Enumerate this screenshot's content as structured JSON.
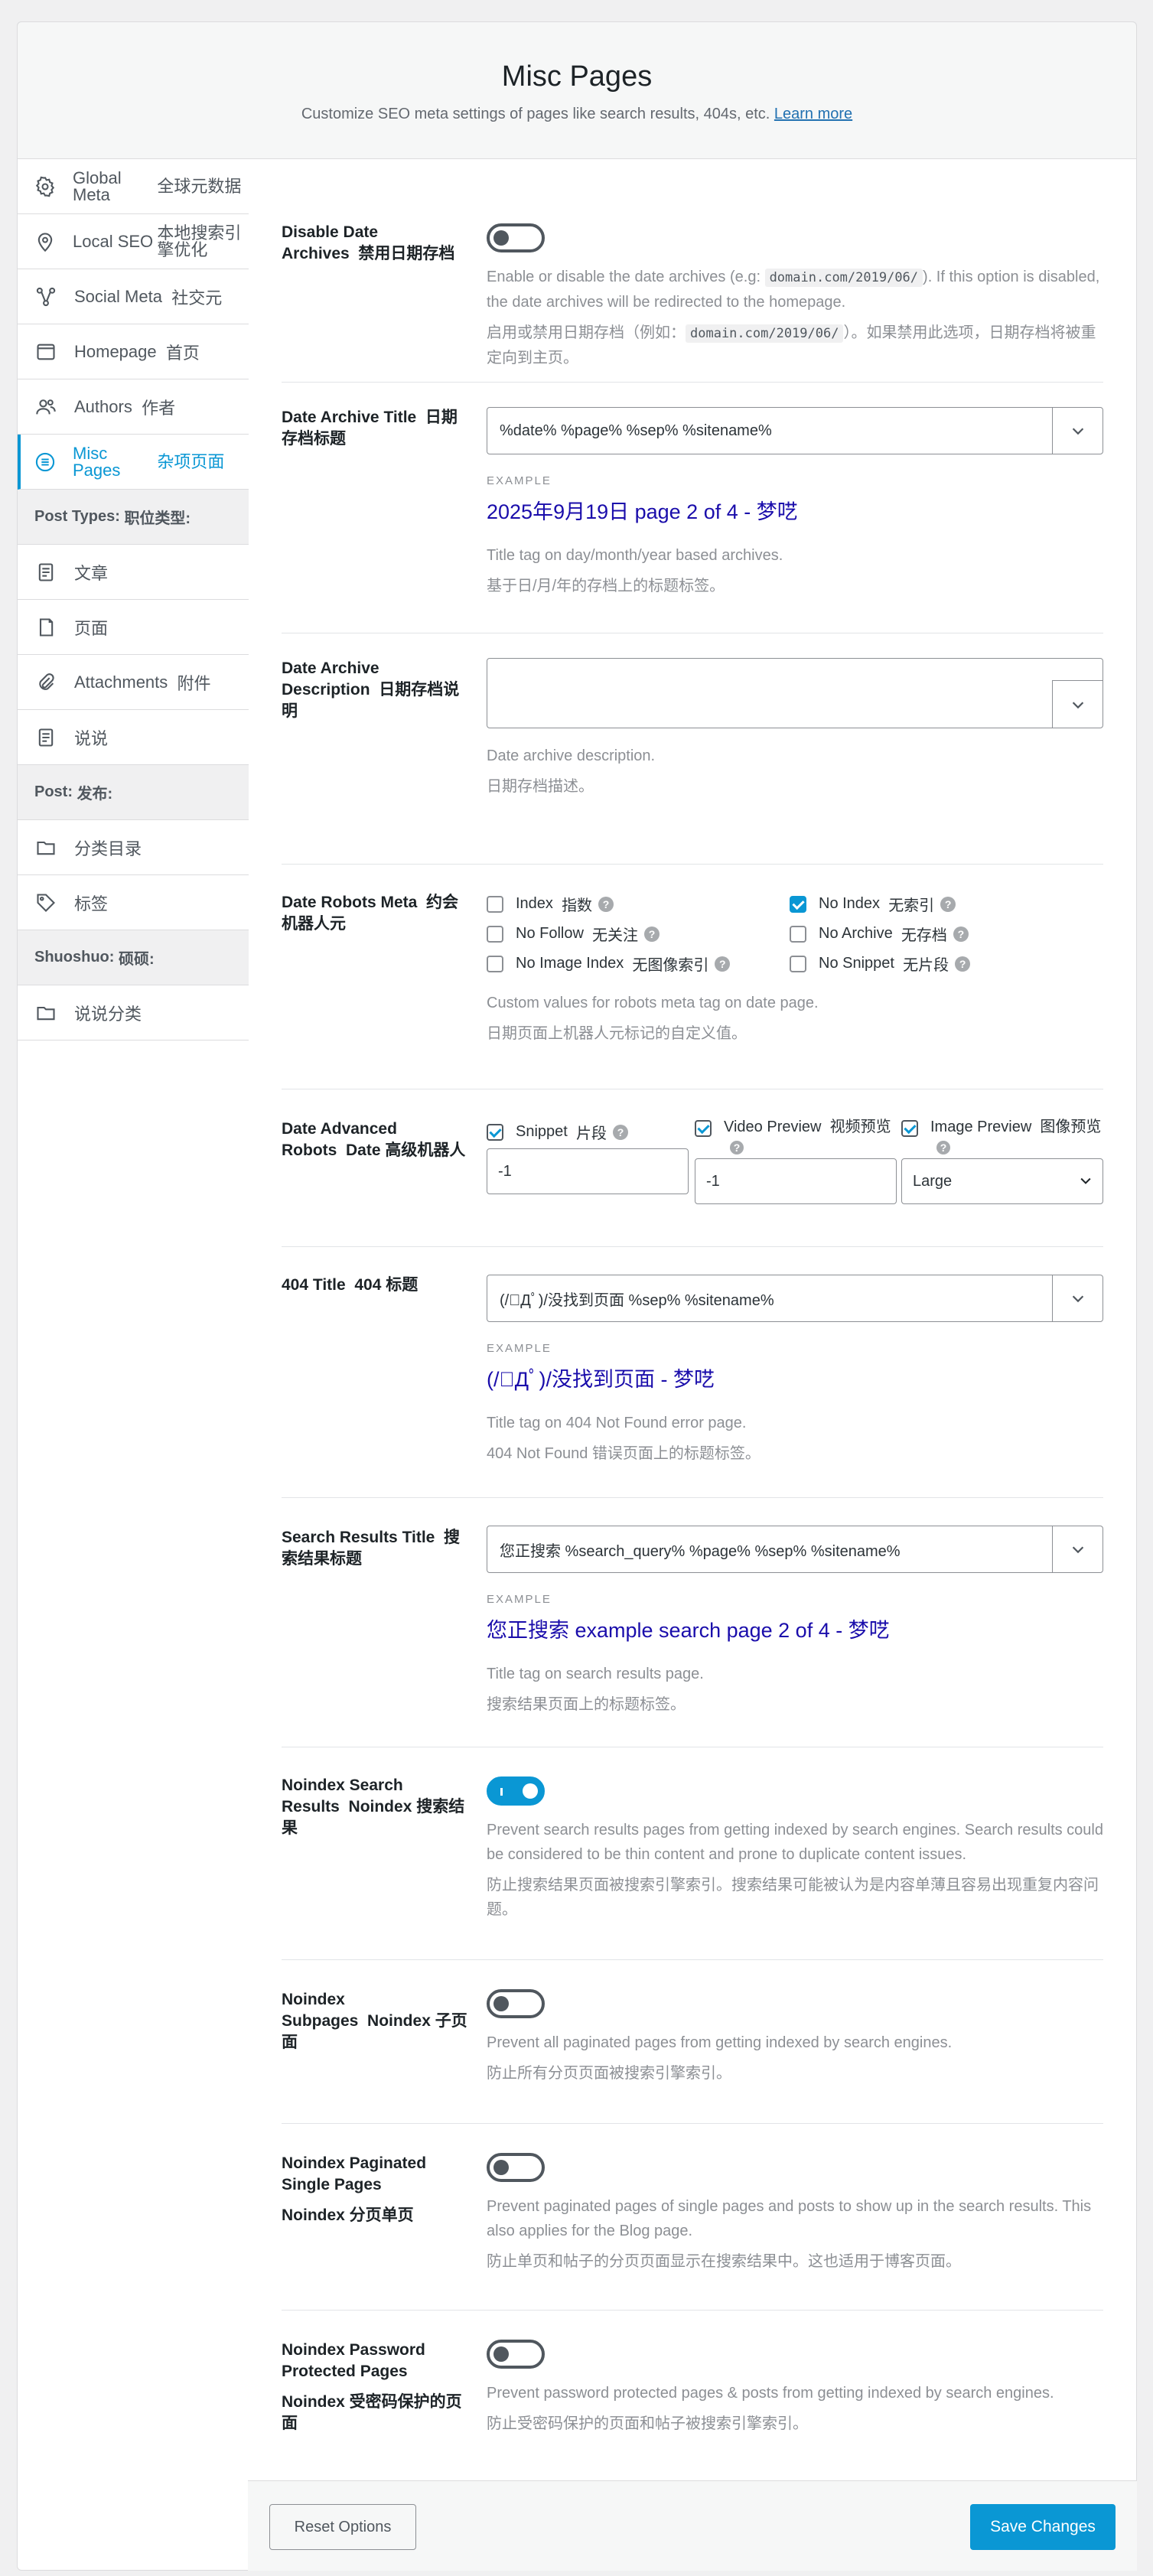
{
  "header": {
    "title": "Misc Pages",
    "subtitle": "Customize SEO meta settings of pages like search results, 404s, etc.",
    "learn_more": "Learn more"
  },
  "sidebar": {
    "items": [
      {
        "label": "Global Meta",
        "label_zh": "全球元数据",
        "icon": "gear-icon"
      },
      {
        "label": "Local SEO",
        "label_zh": "本地搜索引擎优化",
        "icon": "location-pin-icon"
      },
      {
        "label": "Social Meta",
        "label_zh": "社交元",
        "icon": "share-nodes-icon"
      },
      {
        "label": "Homepage",
        "label_zh": "首页",
        "icon": "browser-window-icon"
      },
      {
        "label": "Authors",
        "label_zh": "作者",
        "icon": "users-icon"
      },
      {
        "label": "Misc Pages",
        "label_zh": "杂项页面",
        "icon": "list-circle-icon"
      }
    ],
    "post_types_heading": "Post Types:",
    "post_types_heading_zh": "职位类型:",
    "post_types": [
      {
        "label": "文章",
        "icon": "document-icon"
      },
      {
        "label": "页面",
        "icon": "page-icon"
      },
      {
        "label": "Attachments",
        "label_zh": "附件",
        "icon": "paperclip-icon"
      },
      {
        "label": "说说",
        "icon": "document-icon"
      }
    ],
    "post_heading": "Post:",
    "post_heading_zh": "发布:",
    "post_tax": [
      {
        "label": "分类目录",
        "icon": "folder-icon"
      },
      {
        "label": "标签",
        "icon": "tag-icon"
      }
    ],
    "shuoshuo_heading": "Shuoshuo:",
    "shuoshuo_heading_zh": "硕硕:",
    "shuoshuo_tax": [
      {
        "label": "说说分类",
        "icon": "folder-icon"
      }
    ]
  },
  "settings": {
    "date_archives": {
      "label": "Disable Date Archives",
      "label_zh": "禁用日期存档",
      "desc1_a": "Enable or disable the date archives (e.g:",
      "desc1_code": "domain.com/2019/06/",
      "desc1_b": "). If this option is disabled, the date archives will be redirected to the homepage.",
      "desc2_a": "启用或禁用日期存档（例如：",
      "desc2_code": "domain.com/2019/06/",
      "desc2_b": "）。如果禁用此选项，日期存档将被重定向到主页。",
      "enabled": false
    },
    "date_title": {
      "label": "Date Archive Title",
      "label_zh": "日期存档标题",
      "value": "%date% %page% %sep% %sitename%",
      "example_tag": "EXAMPLE",
      "example": "2025年9月19日 page 2 of 4 - 梦呓",
      "desc": "Title tag on day/month/year based archives.",
      "desc_zh": "基于日/月/年的存档上的标题标签。"
    },
    "date_desc": {
      "label": "Date Archive Description",
      "label_zh": "日期存档说明",
      "value": "",
      "desc": "Date archive description.",
      "desc_zh": "日期存档描述。"
    },
    "robots": {
      "label": "Date Robots Meta",
      "label_zh": "约会机器人元",
      "options": [
        {
          "label": "Index",
          "label_zh": "指数",
          "checked": false
        },
        {
          "label": "No Index",
          "label_zh": "无索引",
          "checked": true
        },
        {
          "label": "No Follow",
          "label_zh": "无关注",
          "checked": false
        },
        {
          "label": "No Archive",
          "label_zh": "无存档",
          "checked": false
        },
        {
          "label": "No Image Index",
          "label_zh": "无图像索引",
          "checked": false
        },
        {
          "label": "No Snippet",
          "label_zh": "无片段",
          "checked": false
        }
      ],
      "desc": "Custom values for robots meta tag on date page.",
      "desc_zh": "日期页面上机器人元标记的自定义值。"
    },
    "advanced": {
      "label": "Date Advanced Robots",
      "label_zh": "Date 高级机器人",
      "snippet_label": "Snippet",
      "snippet_label_zh": "片段",
      "snippet_value": "-1",
      "video_label": "Video Preview",
      "video_label_zh": "视频预览",
      "video_value": "-1",
      "image_label": "Image Preview",
      "image_label_zh": "图像预览",
      "image_value": "Large"
    },
    "title_404": {
      "label": "404 Title",
      "label_zh": "404 标题",
      "value": "(/ﾟДﾟ)/没找到页面 %sep% %sitename%",
      "example_tag": "EXAMPLE",
      "example": "(/ﾟДﾟ)/没找到页面 - 梦呓",
      "desc": "Title tag on 404 Not Found error page.",
      "desc_zh": "404 Not Found 错误页面上的标题标签。"
    },
    "search_title": {
      "label": "Search Results Title",
      "label_zh": "搜索结果标题",
      "value": "您正搜索 %search_query% %page% %sep% %sitename%",
      "example_tag": "EXAMPLE",
      "example": "您正搜索 example search page 2 of 4 - 梦呓",
      "desc": "Title tag on search results page.",
      "desc_zh": "搜索结果页面上的标题标签。"
    },
    "noindex_search": {
      "label": "Noindex Search Results",
      "label_zh": "Noindex 搜索结果",
      "enabled": true,
      "desc": "Prevent search results pages from getting indexed by search engines. Search results could be considered to be thin content and prone to duplicate content issues.",
      "desc_zh": "防止搜索结果页面被搜索引擎索引。搜索结果可能被认为是内容单薄且容易出现重复内容问题。"
    },
    "noindex_subpages": {
      "label": "Noindex Subpages",
      "label_zh": "Noindex 子页面",
      "enabled": false,
      "desc": "Prevent all paginated pages from getting indexed by search engines.",
      "desc_zh": "防止所有分页页面被搜索引擎索引。"
    },
    "noindex_paginated": {
      "label": "Noindex Paginated Single Pages",
      "label_zh": "Noindex 分页单页",
      "enabled": false,
      "desc": "Prevent paginated pages of single pages and posts to show up in the search results. This also applies for the Blog page.",
      "desc_zh": "防止单页和帖子的分页页面显示在搜索结果中。这也适用于博客页面。"
    },
    "noindex_password": {
      "label": "Noindex Password Protected Pages",
      "label_zh": "Noindex 受密码保护的页面",
      "enabled": false,
      "desc": "Prevent password protected pages & posts from getting indexed by search engines.",
      "desc_zh": "防止受密码保护的页面和帖子被搜索引擎索引。"
    }
  },
  "footer": {
    "reset_label": "Reset Options",
    "save_label": "Save Changes"
  },
  "colors": {
    "accent": "#0a97d4",
    "example_title": "#1a0dab",
    "muted_text": "#8c8f94"
  }
}
